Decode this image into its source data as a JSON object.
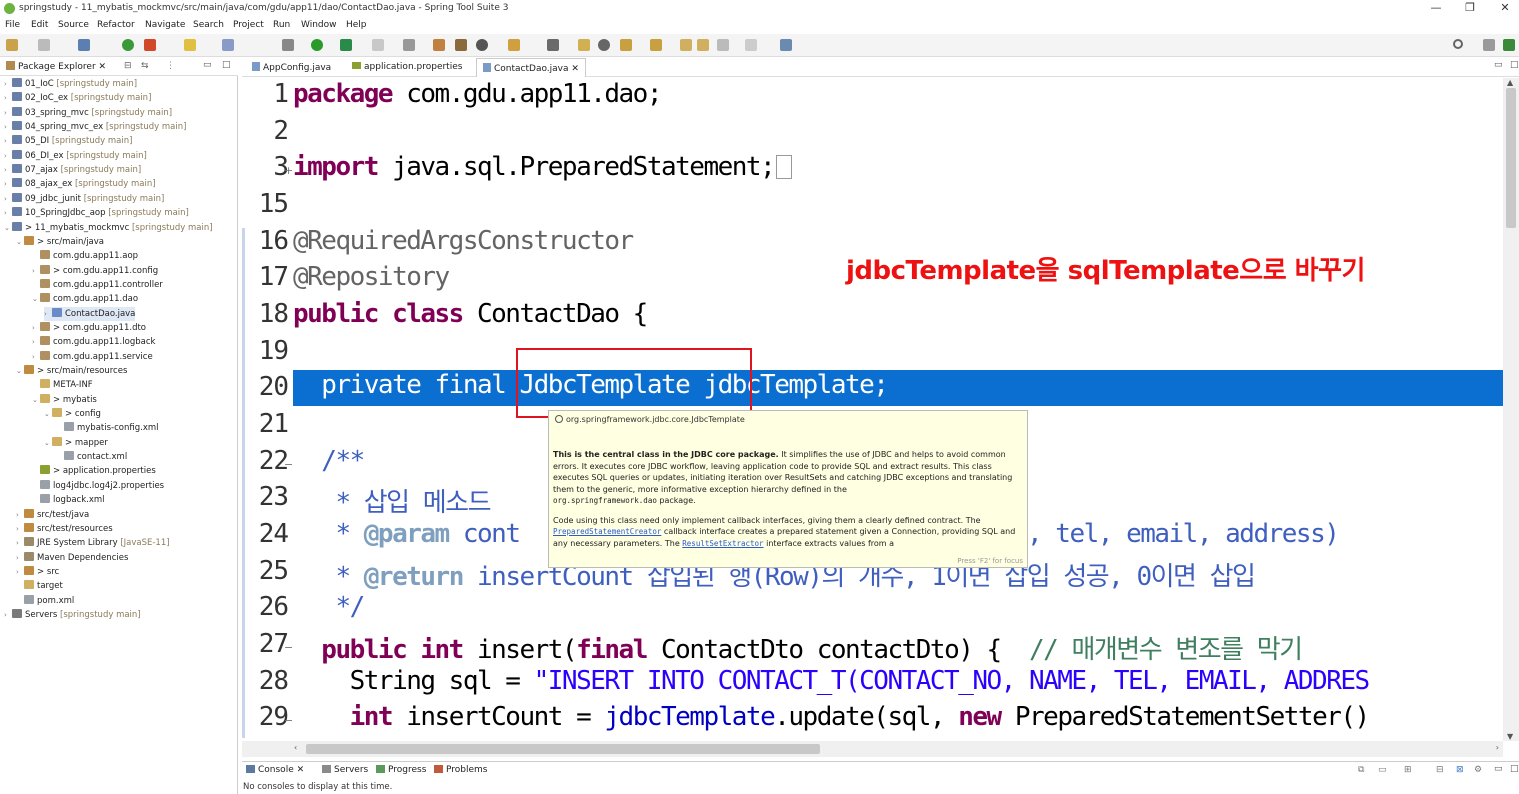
{
  "window": {
    "title": "springstudy - 11_mybatis_mockmvc/src/main/java/com/gdu/app11/dao/ContactDao.java - Spring Tool Suite 3",
    "minimize": "—",
    "restore": "❐",
    "close": "✕"
  },
  "menu": [
    "File",
    "Edit",
    "Source",
    "Refactor",
    "Navigate",
    "Search",
    "Project",
    "Run",
    "Window",
    "Help"
  ],
  "package_explorer": {
    "tab_label": "Package Explorer",
    "items": [
      {
        "label": "01_IoC",
        "deco": "[springstudy main]"
      },
      {
        "label": "02_IoC_ex",
        "deco": "[springstudy main]"
      },
      {
        "label": "03_spring_mvc",
        "deco": "[springstudy main]"
      },
      {
        "label": "04_spring_mvc_ex",
        "deco": "[springstudy main]"
      },
      {
        "label": "05_DI",
        "deco": "[springstudy main]"
      },
      {
        "label": "06_DI_ex",
        "deco": "[springstudy main]"
      },
      {
        "label": "07_ajax",
        "deco": "[springstudy main]"
      },
      {
        "label": "08_ajax_ex",
        "deco": "[springstudy main]"
      },
      {
        "label": "09_jdbc_junit",
        "deco": "[springstudy main]"
      },
      {
        "label": "10_SpringJdbc_aop",
        "deco": "[springstudy main]"
      },
      {
        "label": "> 11_mybatis_mockmvc",
        "deco": "[springstudy main]"
      },
      {
        "label": "> src/main/java",
        "deco": ""
      },
      {
        "label": "com.gdu.app11.aop",
        "deco": ""
      },
      {
        "label": "> com.gdu.app11.config",
        "deco": ""
      },
      {
        "label": "com.gdu.app11.controller",
        "deco": ""
      },
      {
        "label": "com.gdu.app11.dao",
        "deco": ""
      },
      {
        "label": "ContactDao.java",
        "deco": ""
      },
      {
        "label": "> com.gdu.app11.dto",
        "deco": ""
      },
      {
        "label": "com.gdu.app11.logback",
        "deco": ""
      },
      {
        "label": "com.gdu.app11.service",
        "deco": ""
      },
      {
        "label": "> src/main/resources",
        "deco": ""
      },
      {
        "label": "META-INF",
        "deco": ""
      },
      {
        "label": "> mybatis",
        "deco": ""
      },
      {
        "label": "> config",
        "deco": ""
      },
      {
        "label": "mybatis-config.xml",
        "deco": ""
      },
      {
        "label": "> mapper",
        "deco": ""
      },
      {
        "label": "contact.xml",
        "deco": ""
      },
      {
        "label": "> application.properties",
        "deco": ""
      },
      {
        "label": "log4jdbc.log4j2.properties",
        "deco": ""
      },
      {
        "label": "logback.xml",
        "deco": ""
      },
      {
        "label": "src/test/java",
        "deco": ""
      },
      {
        "label": "src/test/resources",
        "deco": ""
      },
      {
        "label": "JRE System Library",
        "deco": "[JavaSE-11]"
      },
      {
        "label": "Maven Dependencies",
        "deco": ""
      },
      {
        "label": "> src",
        "deco": ""
      },
      {
        "label": "target",
        "deco": ""
      },
      {
        "label": "pom.xml",
        "deco": ""
      },
      {
        "label": "Servers",
        "deco": "[springstudy main]"
      }
    ]
  },
  "editor_tabs": [
    "AppConfig.java",
    "application.properties",
    "ContactDao.java"
  ],
  "editor": {
    "lines": {
      "l1": "1",
      "l2": "2",
      "l3": "3",
      "l15": "15",
      "l16": "16",
      "l17": "17",
      "l18": "18",
      "l19": "19",
      "l20": "20",
      "l21": "21",
      "l22": "22",
      "l23": "23",
      "l24": "24",
      "l25": "25",
      "l26": "26",
      "l27": "27",
      "l28": "28",
      "l29": "29"
    },
    "code": {
      "c1_kw": "package",
      "c1_rest": " com.gdu.app11.dao;",
      "c3_kw": "import",
      "c3_rest": " java.sql.PreparedStatement;",
      "c16": "@RequiredArgsConstructor",
      "c17": "@Repository",
      "c18_kw": "public class",
      "c18_rest": " ContactDao {",
      "c20": "  private final JdbcTemplate jdbcTemplate;",
      "c22": "  /**",
      "c23": "   * 삽입 메소드",
      "c24_pre": "   * ",
      "c24_tag": "@param",
      "c24_rest": " cont",
      "c24_tail": ", tel, email, address)",
      "c25_pre": "   * ",
      "c25_tag": "@return",
      "c25_rest": " insertCount 삽입된 행(Row)의 개수, 1이면 삽입 성공, 0이면 삽입",
      "c26": "   */",
      "c27_kw1": "  public int",
      "c27_mid": " insert(",
      "c27_kw2": "final",
      "c27_rest": " ContactDto contactDto) {  ",
      "c27_cm": "// 매개변수 변조를 막기",
      "c28_pre": "    String sql = ",
      "c28_str": "\"INSERT INTO CONTACT_T(CONTACT_NO, NAME, TEL, EMAIL, ADDRES",
      "c29_kw": "    int",
      "c29_mid": " insertCount = ",
      "c29_fld": "jdbcTemplate",
      "c29_mid2": ".update(sql, ",
      "c29_kw2": "new",
      "c29_rest": " PreparedStatementSetter()"
    }
  },
  "annotation_note": "jdbcTemplate을 sqlTemplate으로 바꾸기",
  "hover": {
    "header": "org.springframework.jdbc.core.JdbcTemplate",
    "p1_bold": "This is the central class in the JDBC core package.",
    "p1_rest": " It simplifies the use of JDBC and helps to avoid common errors. It executes core JDBC workflow, leaving application code to provide SQL and extract results. This class executes SQL queries or updates, initiating iteration over ResultSets and catching JDBC exceptions and translating them to the generic, more informative exception hierarchy defined in the",
    "p1_pkg": "org.springframework.dao",
    "p1_end": " package.",
    "p2_start": "Code using this class need only implement callback interfaces, giving them a clearly defined contract. The",
    "p2_link": "PreparedStatementCreator",
    "p2_rest": " callback interface creates a prepared statement given a Connection, providing SQL and any necessary parameters. The",
    "p2_link2": "ResultSetExtractor",
    "p2_end": " interface extracts values from a",
    "focus_hint": "Press 'F2' for focus"
  },
  "bottom_tabs": [
    "Console",
    "Servers",
    "Progress",
    "Problems"
  ],
  "console_text": "No consoles to display at this time."
}
